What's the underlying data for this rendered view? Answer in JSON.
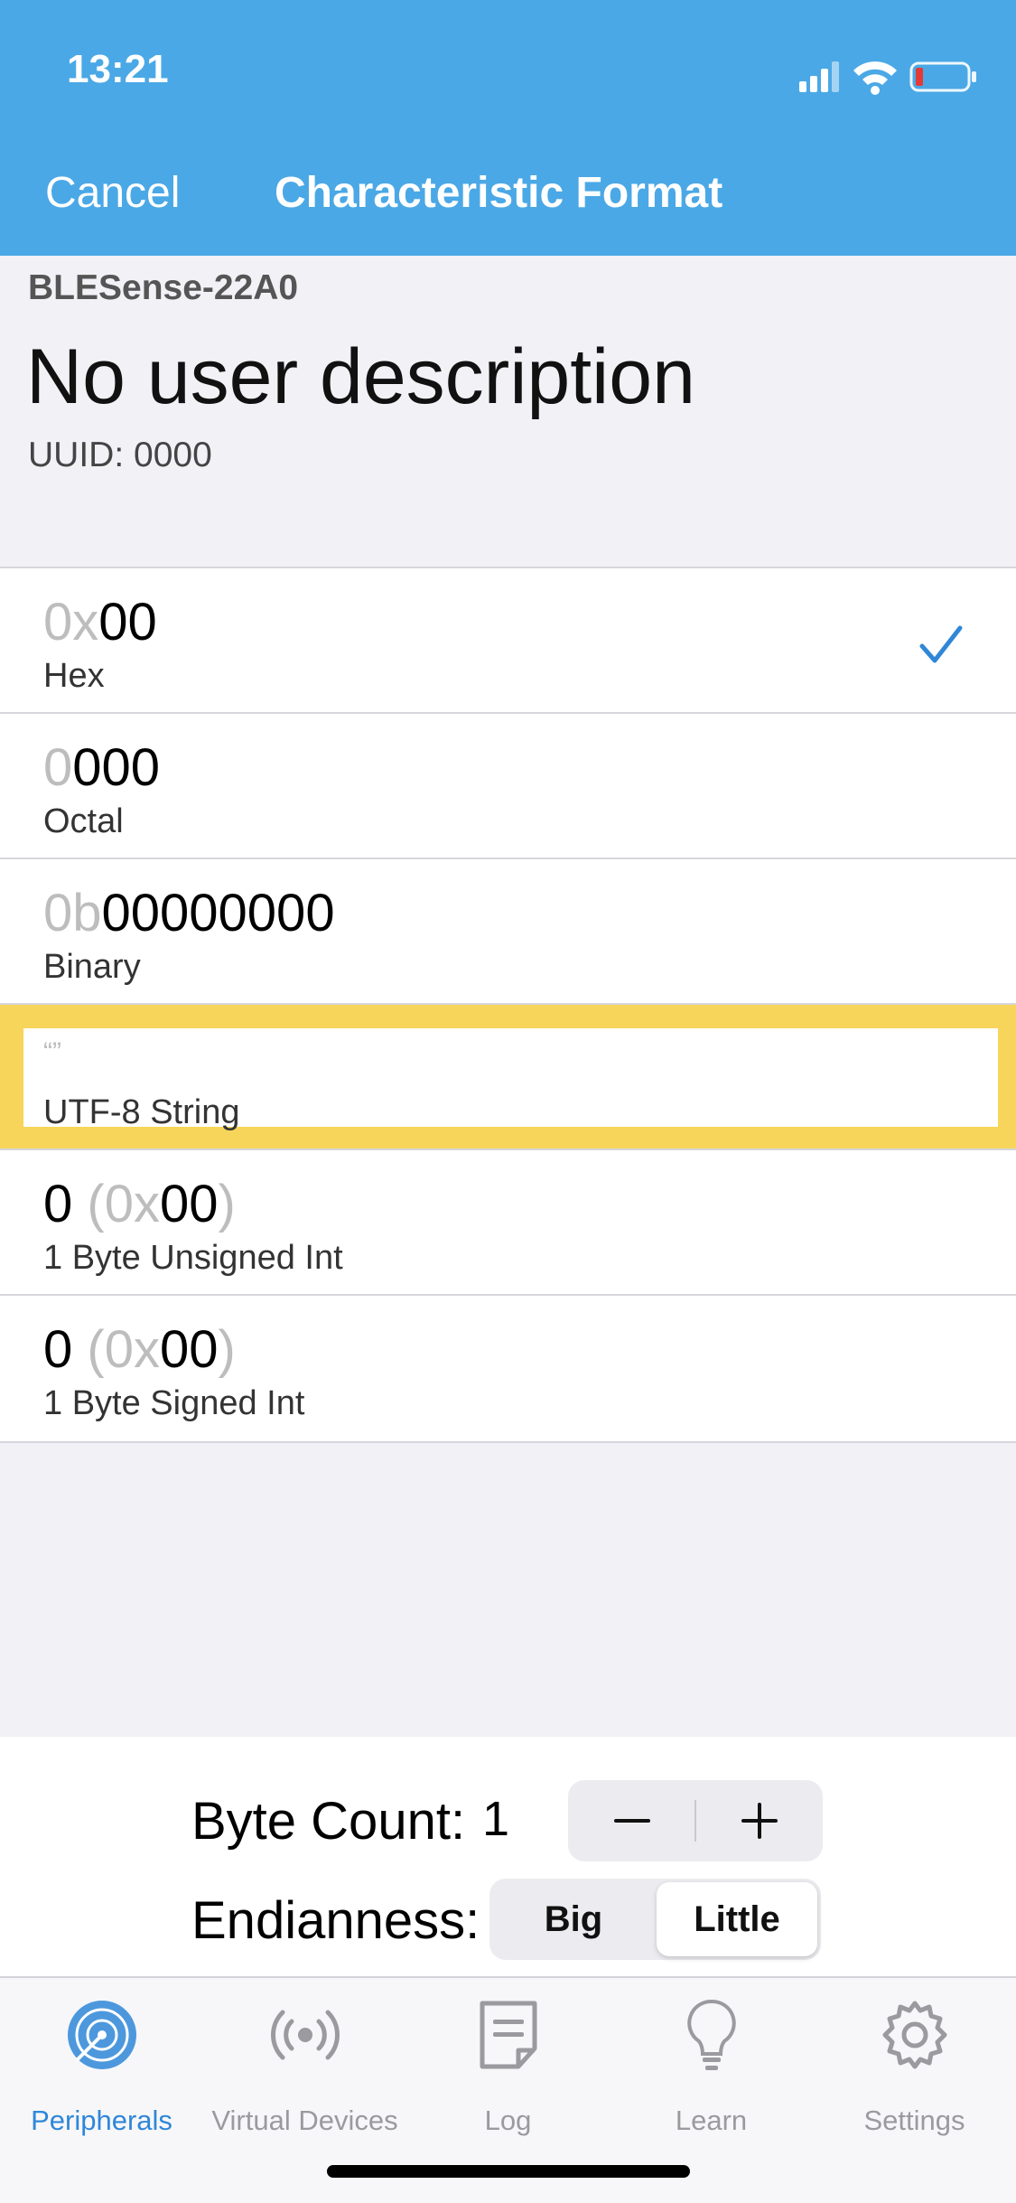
{
  "status": {
    "time": "13:21"
  },
  "nav": {
    "cancel": "Cancel",
    "title": "Characteristic Format"
  },
  "info": {
    "device": "BLESense-22A0",
    "description": "No user description",
    "uuid": "UUID: 0000"
  },
  "formats": [
    {
      "prefix": "0x",
      "value": "00",
      "label": "Hex",
      "selected": true
    },
    {
      "prefix": "0",
      "value": "000",
      "label": "Octal"
    },
    {
      "prefix": "0b",
      "value": "00000000",
      "label": "Binary"
    },
    {
      "value": "“”",
      "label": "UTF-8 String",
      "highlighted": true
    },
    {
      "int": "0",
      "paren_open": "(",
      "hex_prefix": "0x",
      "hex_value": "00",
      "paren_close": ")",
      "label": "1 Byte Unsigned Int"
    },
    {
      "int": "0",
      "paren_open": "(",
      "hex_prefix": "0x",
      "hex_value": "00",
      "paren_close": ")",
      "label": "1 Byte Signed Int"
    }
  ],
  "controls": {
    "byte_count_label": "Byte Count:",
    "byte_count_value": "1",
    "endianness_label": "Endianness:",
    "endian_options": [
      "Big",
      "Little"
    ],
    "endian_selected": "Little"
  },
  "tabs": [
    {
      "label": "Peripherals",
      "icon": "radar-icon",
      "active": true
    },
    {
      "label": "Virtual Devices",
      "icon": "broadcast-icon"
    },
    {
      "label": "Log",
      "icon": "log-note-icon"
    },
    {
      "label": "Learn",
      "icon": "lightbulb-icon"
    },
    {
      "label": "Settings",
      "icon": "gear-icon"
    }
  ],
  "colors": {
    "header": "#4ba8e6",
    "accent": "#2f87d8",
    "highlight": "#f7d55a",
    "battery_low": "#e53935"
  }
}
